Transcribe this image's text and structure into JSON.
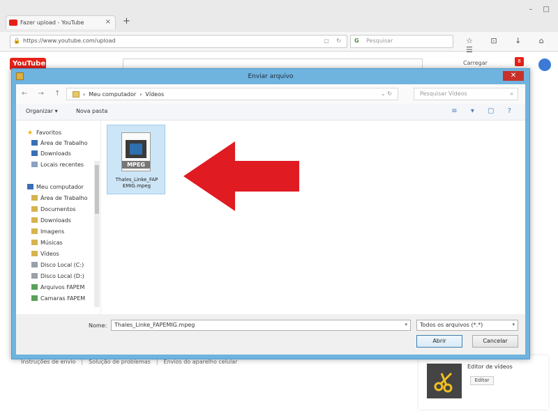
{
  "browser": {
    "tab_title": "Fazer upload - YouTube",
    "tab_close": "×",
    "new_tab": "+",
    "window_controls": "–  □",
    "url": "https://www.youtube.com/upload",
    "search_placeholder": "Pesquisar",
    "toolbar_icons": "☆ ⊡ ↓ ⌂ ☰"
  },
  "youtube": {
    "logo": "YouTube",
    "signin": "Carregar",
    "bell_badge": "8",
    "help_links": [
      "Instruções de envio",
      "Solução de problemas",
      "Envios do aparelho celular"
    ],
    "editor_title": "Editor de vídeos",
    "editor_button": "Editar"
  },
  "dialog": {
    "title": "Enviar arquivo",
    "close": "✕",
    "nav_arrows": "← → ↑",
    "breadcrumb": [
      "Meu computador",
      "Vídeos"
    ],
    "breadcrumb_sep": "›",
    "breadcrumb_end": "⌄ ↻",
    "search_placeholder": "Pesquisar Vídeos",
    "organize": "Organizar ▾",
    "new_folder": "Nova pasta",
    "view_icons": "≡ ▾ ▢ ?",
    "nav_items": [
      "Favoritos",
      "Área de Trabalho",
      "Downloads",
      "Locais recentes",
      "Meu computador",
      "Área de Trabalho",
      "Documentos",
      "Downloads",
      "Imagens",
      "Músicas",
      "Vídeos",
      "Disco Local (C:)",
      "Disco Local (D:)",
      "Arquivos FAPEM",
      "Camaras FAPEM"
    ],
    "file": {
      "name": "Thales_Linke_FAPEMIG.mpeg",
      "name_wrapped": "Thales_Linke_FAP EMIG.mpeg",
      "type_label": "MPEG"
    },
    "name_label": "Nome:",
    "name_value": "Thales_Linke_FAPEMIG.mpeg",
    "type_value": "Todos os arquivos (*.*)",
    "open_button": "Abrir",
    "cancel_button": "Cancelar"
  },
  "colors": {
    "accent_red": "#e62117",
    "dialog_frame": "#6fb3df",
    "selection": "#cde6f7",
    "arrow": "#e11b22"
  }
}
